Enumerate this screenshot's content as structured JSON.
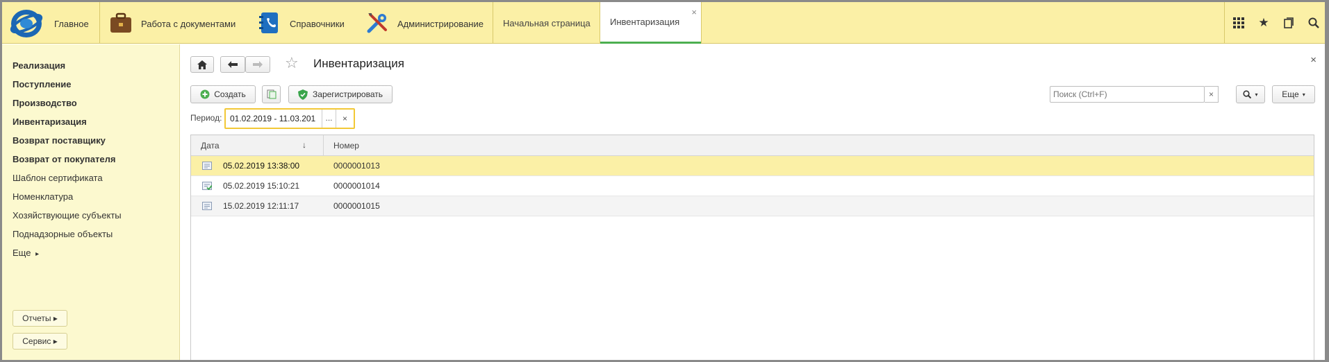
{
  "topbar": {
    "main_label": "Главное",
    "sections": [
      {
        "label": "Работа с документами",
        "icon": "briefcase-icon"
      },
      {
        "label": "Справочники",
        "icon": "contacts-book-icon"
      },
      {
        "label": "Администрирование",
        "icon": "tools-icon"
      }
    ],
    "tabs": [
      {
        "label": "Начальная страница",
        "active": false
      },
      {
        "label": "Инвентаризация",
        "active": true,
        "close": "×"
      }
    ],
    "right_icons": [
      "grid-icon",
      "star-icon",
      "history-icon",
      "search-icon"
    ],
    "accent_color": "#fbf0a6"
  },
  "sidebar": {
    "items": [
      {
        "label": "Реализация",
        "bold": true
      },
      {
        "label": "Поступление",
        "bold": true
      },
      {
        "label": "Производство",
        "bold": true
      },
      {
        "label": "Инвентаризация",
        "bold": true
      },
      {
        "label": "Возврат поставщику",
        "bold": true
      },
      {
        "label": "Возврат от покупателя",
        "bold": true
      },
      {
        "label": "Шаблон сертификата",
        "bold": false
      },
      {
        "label": "Номенклатура",
        "bold": false
      },
      {
        "label": "Хозяйствующие субъекты",
        "bold": false
      },
      {
        "label": "Поднадзорные объекты",
        "bold": false
      },
      {
        "label": "Еще",
        "bold": false
      }
    ],
    "more_arrow": "▸",
    "buttons": [
      {
        "label": "Отчеты ▸"
      },
      {
        "label": "Сервис ▸"
      }
    ]
  },
  "content": {
    "title": "Инвентаризация",
    "close": "×",
    "toolbar": {
      "create_label": "Создать",
      "register_label": "Зарегистрировать",
      "more_label": "Еще",
      "search_placeholder": "Поиск (Ctrl+F)",
      "search_clear": "×"
    },
    "period": {
      "label": "Период:",
      "value": "01.02.2019 - 11.03.201",
      "dots": "...",
      "clear": "×"
    },
    "table": {
      "columns": [
        "Дата",
        "Номер"
      ],
      "sort_arrow": "↓",
      "rows": [
        {
          "date": "05.02.2019 13:38:00",
          "number": "0000001013",
          "selected": true,
          "posted": false
        },
        {
          "date": "05.02.2019 15:10:21",
          "number": "0000001014",
          "selected": false,
          "posted": true
        },
        {
          "date": "15.02.2019 12:11:17",
          "number": "0000001015",
          "selected": false,
          "posted": false
        }
      ]
    }
  }
}
